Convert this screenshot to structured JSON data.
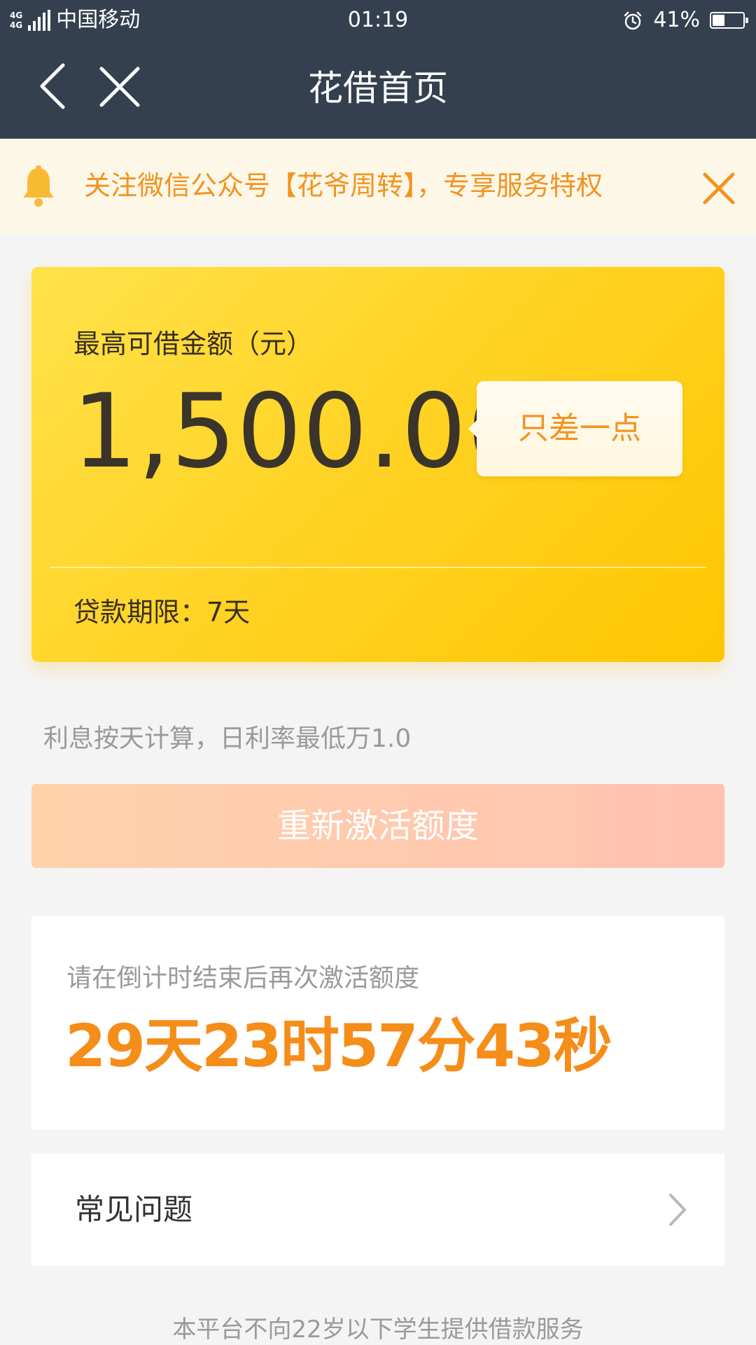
{
  "status_bar": {
    "network_1": "4G",
    "network_2": "4G",
    "carrier": "中国移动",
    "time": "01:19",
    "battery_text": "41%",
    "battery_level": 0.41,
    "icons": [
      "signal-icon",
      "alarm-icon",
      "battery-icon"
    ]
  },
  "nav": {
    "title": "花借首页",
    "icons": [
      "back-arrow-icon",
      "close-icon"
    ]
  },
  "notice": {
    "text": "关注微信公众号【花爷周转】，专享服务特权",
    "icons": [
      "bell-icon",
      "close-icon"
    ],
    "color": "#f29320"
  },
  "credit_card": {
    "label": "最高可借金额（元）",
    "amount": "1,500.00",
    "tooltip": "只差一点",
    "term": "贷款期限：7天"
  },
  "interest_note": "利息按天计算，日利率最低万1.0",
  "reactivate_button": "重新激活额度",
  "countdown": {
    "label": "请在倒计时结束后再次激活额度",
    "value": "29天23时57分43秒",
    "color": "#f58d19"
  },
  "faq": {
    "label": "常见问题",
    "icon": "chevron-right-icon"
  },
  "footer": "本平台不向22岁以下学生提供借款服务",
  "colors": {
    "header": "#34404f",
    "card_yellow": "#ffd427",
    "accent_orange": "#f29320",
    "button_gradient_start": "#ffd2aa",
    "button_gradient_end": "#ffc2b2"
  }
}
